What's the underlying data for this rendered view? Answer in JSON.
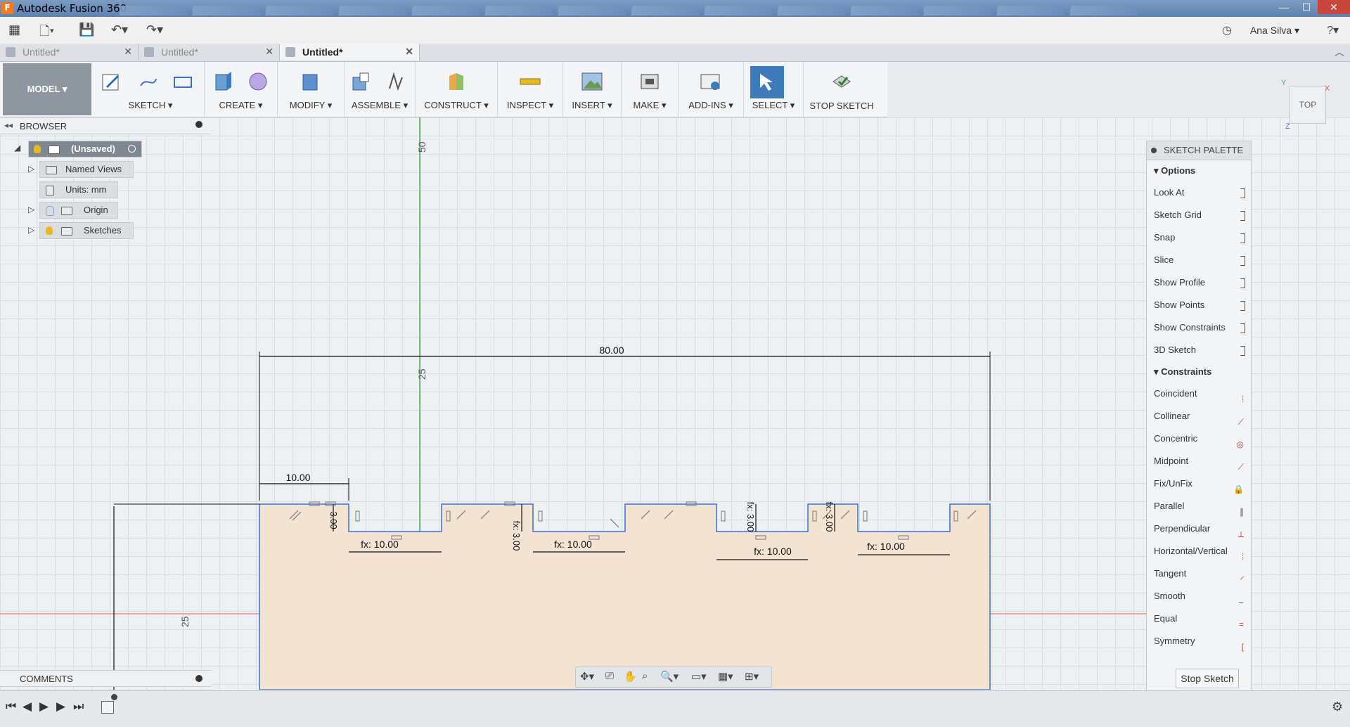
{
  "window": {
    "title": "Autodesk Fusion 360",
    "min": "—",
    "max": "☐",
    "close": "✕"
  },
  "qat": {
    "user": "Ana Silva ▾",
    "help": "?▾"
  },
  "doc_tabs": [
    {
      "label": "Untitled*",
      "close": "✕"
    },
    {
      "label": "Untitled*",
      "close": "✕"
    },
    {
      "label": "Untitled*",
      "close": "✕"
    }
  ],
  "toolbar": {
    "model": "MODEL ▾",
    "groups": [
      "SKETCH ▾",
      "CREATE ▾",
      "MODIFY ▾",
      "ASSEMBLE ▾",
      "CONSTRUCT ▾",
      "INSPECT ▾",
      "INSERT ▾",
      "MAKE ▾",
      "ADD-INS ▾",
      "SELECT ▾",
      "STOP SKETCH"
    ]
  },
  "browser": {
    "title": "BROWSER",
    "root": "(Unsaved)",
    "items": [
      "Named Views",
      "Units: mm",
      "Origin",
      "Sketches"
    ]
  },
  "comments": {
    "title": "COMMENTS"
  },
  "viewcube": {
    "face": "TOP",
    "x": "X",
    "y": "Y",
    "z": "Z"
  },
  "palette": {
    "title": "SKETCH PALETTE",
    "options_header": "Options",
    "options": [
      "Look At",
      "Sketch Grid",
      "Snap",
      "Slice",
      "Show Profile",
      "Show Points",
      "Show Constraints",
      "3D Sketch"
    ],
    "constraints_header": "Constraints",
    "constraints": [
      "Coincident",
      "Collinear",
      "Concentric",
      "Midpoint",
      "Fix/UnFix",
      "Parallel",
      "Perpendicular",
      "Horizontal/Vertical",
      "Tangent",
      "Smooth",
      "Equal",
      "Symmetry"
    ],
    "stop_button": "Stop Sketch"
  },
  "sketch": {
    "dim_total": "80.00",
    "dim_first": "10.00",
    "dim_depth": "3.00",
    "dim_fx_depth": "fx: 3.00",
    "dim_fx_width": "fx: 10.00",
    "ruler_top": "50",
    "ruler_mid": "25",
    "ruler_left": "25"
  },
  "colors": {
    "accent": "#3d7cb8",
    "sketch_line": "#3a6fd8",
    "profile_fill": "#f3e3d3",
    "x_axis": "#e06060",
    "y_axis": "#4caf50"
  }
}
